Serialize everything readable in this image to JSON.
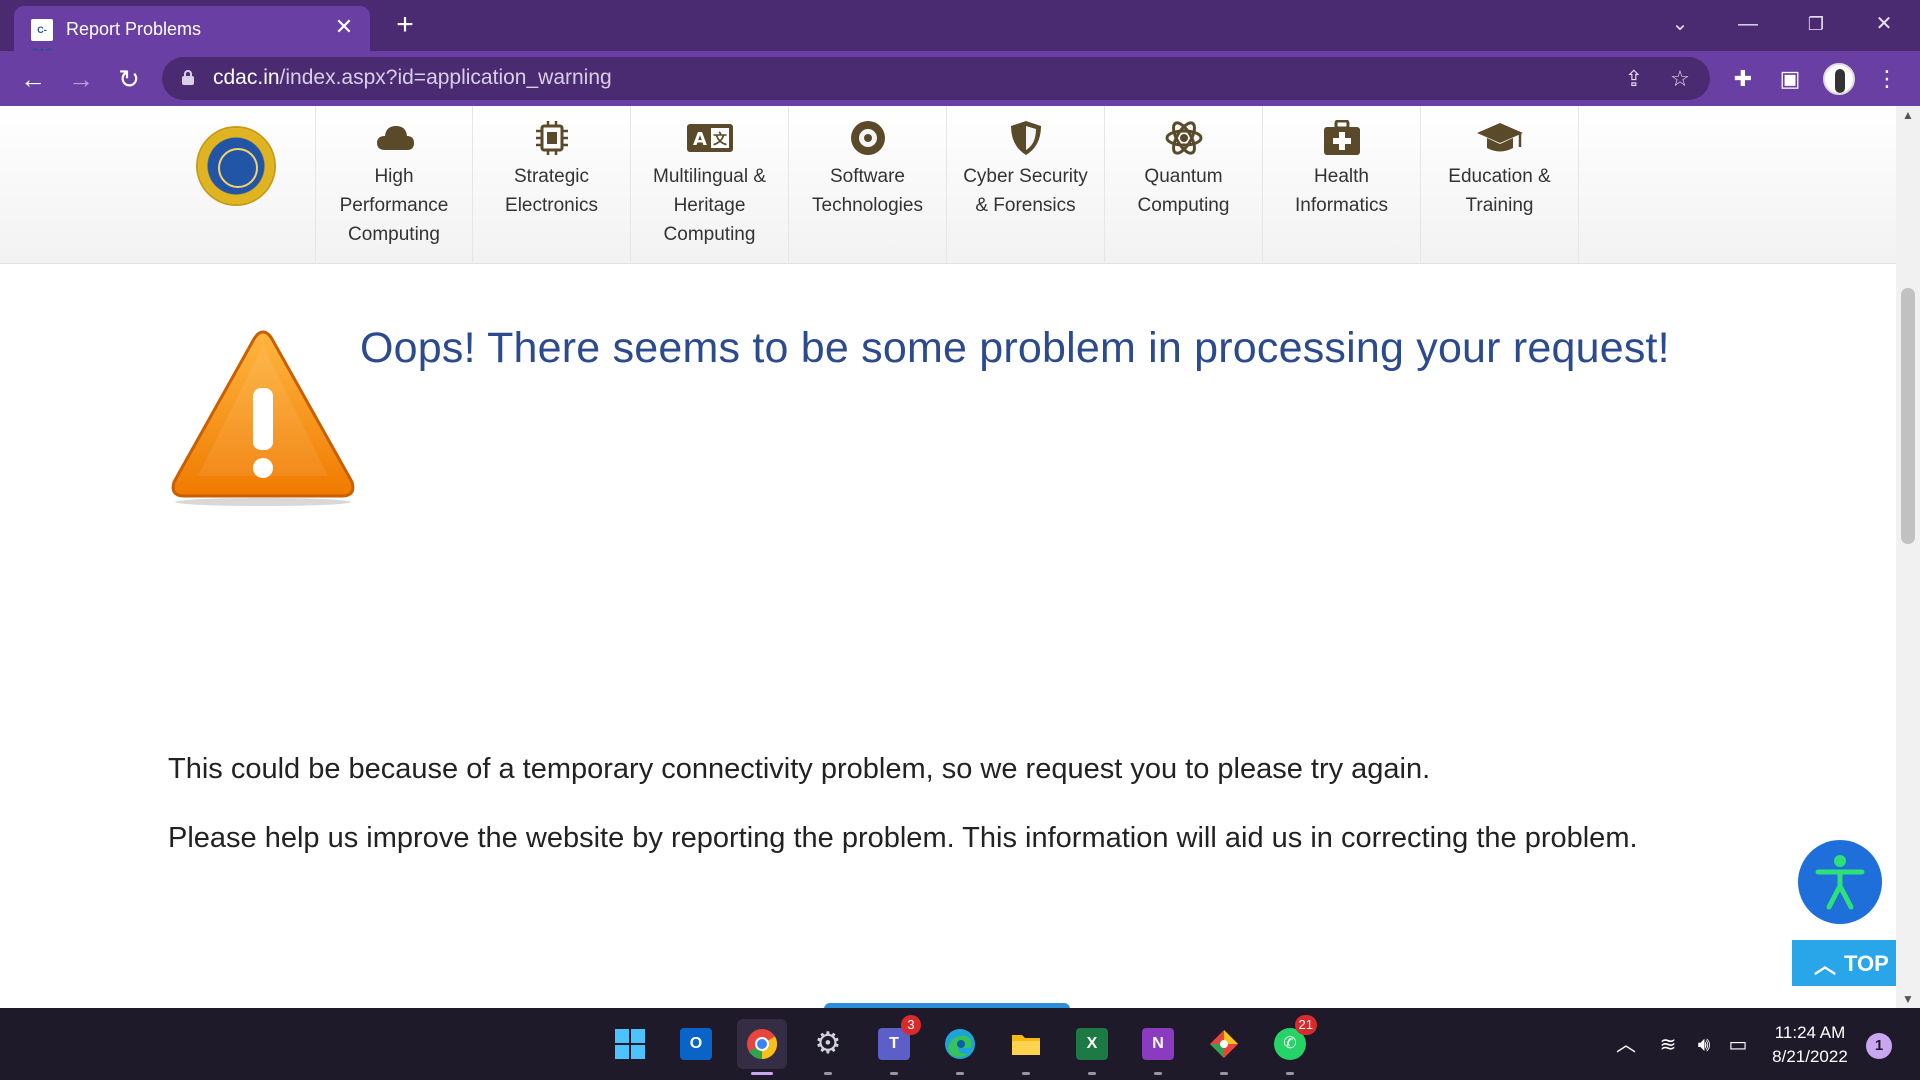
{
  "browser": {
    "tab_title": "Report Problems",
    "tab_favicon_text": "C-DAC",
    "url_domain": "cdac.in",
    "url_path": "/index.aspx?id=application_warning"
  },
  "megamenu": {
    "items": [
      {
        "label": "High Performance Computing",
        "icon": "cloud-icon"
      },
      {
        "label": "Strategic Electronics",
        "icon": "chip-icon"
      },
      {
        "label": "Multilingual & Heritage Computing",
        "icon": "language-icon"
      },
      {
        "label": "Software Technologies",
        "icon": "disc-icon"
      },
      {
        "label": "Cyber Security & Forensics",
        "icon": "shield-icon"
      },
      {
        "label": "Quantum Computing",
        "icon": "atom-icon"
      },
      {
        "label": "Health Informatics",
        "icon": "medical-kit-icon"
      },
      {
        "label": "Education & Training",
        "icon": "graduation-cap-icon"
      }
    ],
    "icon_color": "#5a4a2a"
  },
  "error": {
    "heading": "Oops! There seems to be some problem in processing your request!",
    "paragraph1": "This could be because of a temporary connectivity problem, so we request you to please try again.",
    "paragraph2": "Please help us improve the website by reporting the problem. This information will aid us in correcting the problem.",
    "heading_color": "#2c4a8e"
  },
  "widgets": {
    "top_button_label": "TOP",
    "accessibility_color": "#1f6fdb",
    "top_button_color": "#29a6ea"
  },
  "taskbar": {
    "time": "11:24 AM",
    "date": "8/21/2022",
    "notification_count": "1",
    "teams_badge": "3",
    "whatsapp_badge": "21"
  },
  "theme": {
    "tabbar_color": "#4a2b72",
    "toolbar_color": "#6a3fa4"
  }
}
